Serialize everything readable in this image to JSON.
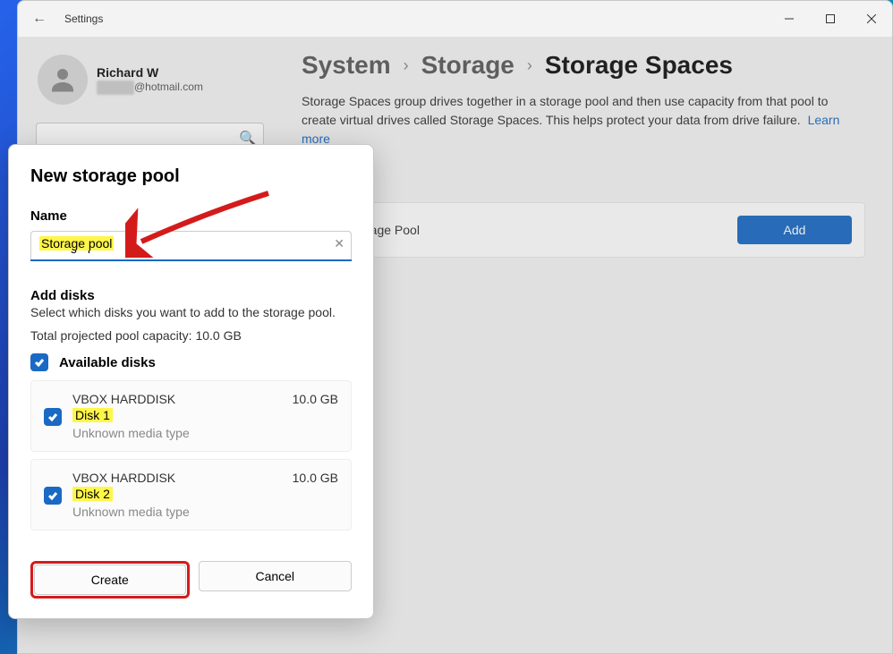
{
  "titlebar": {
    "app_title": "Settings"
  },
  "user": {
    "name": "Richard W",
    "email_suffix": "@hotmail.com"
  },
  "breadcrumb": {
    "p1": "System",
    "p2": "Storage",
    "p3": "Storage Spaces"
  },
  "description": {
    "text": "Storage Spaces group drives together in a storage pool and then use capacity from that pool to create virtual drives called Storage Spaces. This helps protect your data from drive failure.",
    "learn_more": "Learn more"
  },
  "card": {
    "title": "Storage Pool",
    "add": "Add"
  },
  "dialog": {
    "title": "New storage pool",
    "name_label": "Name",
    "name_value": "Storage pool",
    "add_disks": "Add disks",
    "add_disks_sub": "Select which disks you want to add to the storage pool.",
    "capacity": "Total projected pool capacity: 10.0 GB",
    "available": "Available disks",
    "disks": [
      {
        "model": "VBOX HARDDISK",
        "size": "10.0 GB",
        "name": "Disk 1",
        "media": "Unknown media type"
      },
      {
        "model": "VBOX HARDDISK",
        "size": "10.0 GB",
        "name": "Disk 2",
        "media": "Unknown media type"
      }
    ],
    "create": "Create",
    "cancel": "Cancel"
  }
}
